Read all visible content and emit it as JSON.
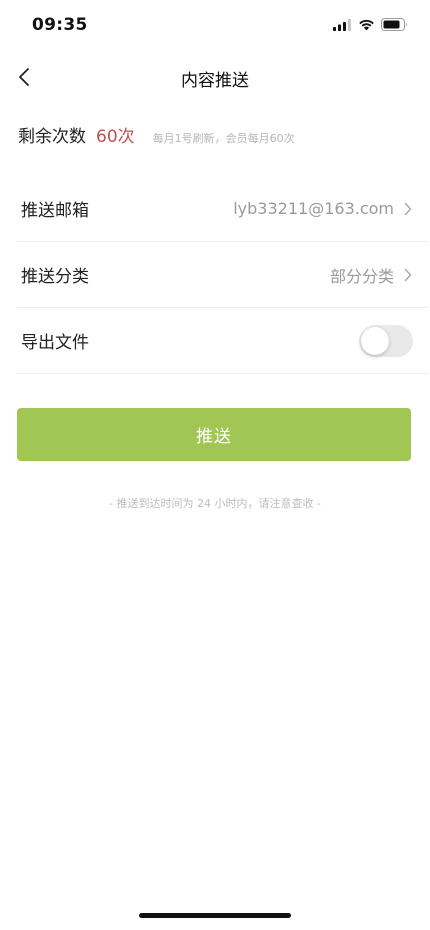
{
  "status_bar": {
    "time": "09:35"
  },
  "nav": {
    "title": "内容推送"
  },
  "quota": {
    "label": "剩余次数",
    "value": "60次",
    "hint": "每月1号刷新，会员每月60次"
  },
  "settings": {
    "email": {
      "label": "推送邮箱",
      "value": "lyb33211@163.com"
    },
    "category": {
      "label": "推送分类",
      "value": "部分分类"
    },
    "export_file": {
      "label": "导出文件",
      "enabled": false
    }
  },
  "push_button": {
    "label": "推送"
  },
  "note": "- 推送到达时间为 24 小时内，请注意查收 -",
  "colors": {
    "accent_green": "#a2c654",
    "quota_red": "#c0504d"
  },
  "icons": {
    "back": "chevron-left-icon",
    "row_arrow": "chevron-right-icon",
    "signal": "cellular-signal-icon",
    "wifi": "wifi-icon",
    "battery": "battery-icon"
  }
}
